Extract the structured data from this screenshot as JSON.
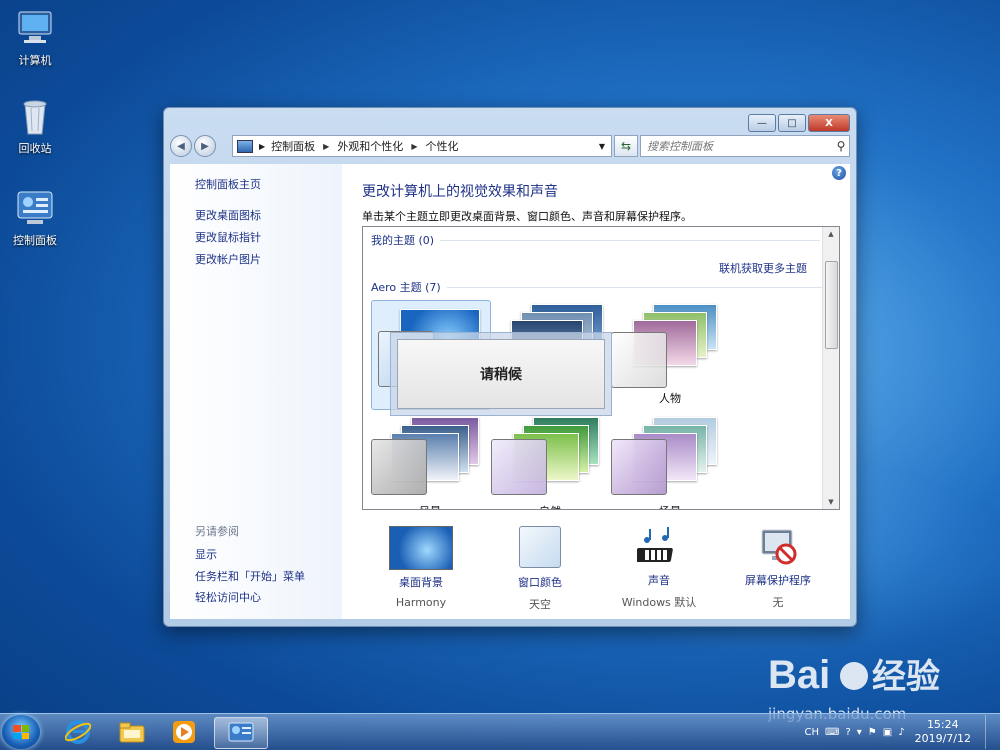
{
  "desktop": {
    "icons": [
      {
        "label": "计算机"
      },
      {
        "label": "回收站"
      },
      {
        "label": "控制面板"
      }
    ]
  },
  "window": {
    "caption_buttons": {
      "minimize": "—",
      "maximize": "□",
      "close": "X"
    },
    "nav": {
      "back": "◀",
      "forward": "▶"
    },
    "breadcrumb": [
      "控制面板",
      "外观和个性化",
      "个性化"
    ],
    "search_placeholder": "搜索控制面板",
    "left_pane": {
      "links": [
        "控制面板主页",
        "更改桌面图标",
        "更改鼠标指针",
        "更改帐户图片"
      ],
      "see_also_title": "另请参阅",
      "see_also": [
        "显示",
        "任务栏和「开始」菜单",
        "轻松访问中心"
      ]
    },
    "main": {
      "title": "更改计算机上的视觉效果和声音",
      "subtitle": "单击某个主题立即更改桌面背景、窗口颜色、声音和屏幕保护程序。",
      "my_themes": "我的主题 (0)",
      "get_more": "联机获取更多主题",
      "aero_themes": "Aero 主题 (7)",
      "themes": [
        {
          "label": "",
          "selected": true
        },
        {
          "label": "",
          "selected": false
        },
        {
          "label": "人物",
          "selected": false
        },
        {
          "label": "风景",
          "selected": false
        },
        {
          "label": "自然",
          "selected": false
        },
        {
          "label": "场景",
          "selected": false
        }
      ],
      "wait_dialog": "请稍候",
      "settings": [
        {
          "label": "桌面背景",
          "value": "Harmony"
        },
        {
          "label": "窗口颜色",
          "value": "天空"
        },
        {
          "label": "声音",
          "value": "Windows 默认"
        },
        {
          "label": "屏幕保护程序",
          "value": "无"
        }
      ]
    }
  },
  "taskbar": {
    "apps": [
      "internet-explorer",
      "windows-explorer",
      "media-player",
      "control-panel"
    ],
    "tray": {
      "lang": "CH",
      "time": "15:24",
      "date": "2019/7/12"
    }
  },
  "watermark": "jingyan.baidu.com"
}
